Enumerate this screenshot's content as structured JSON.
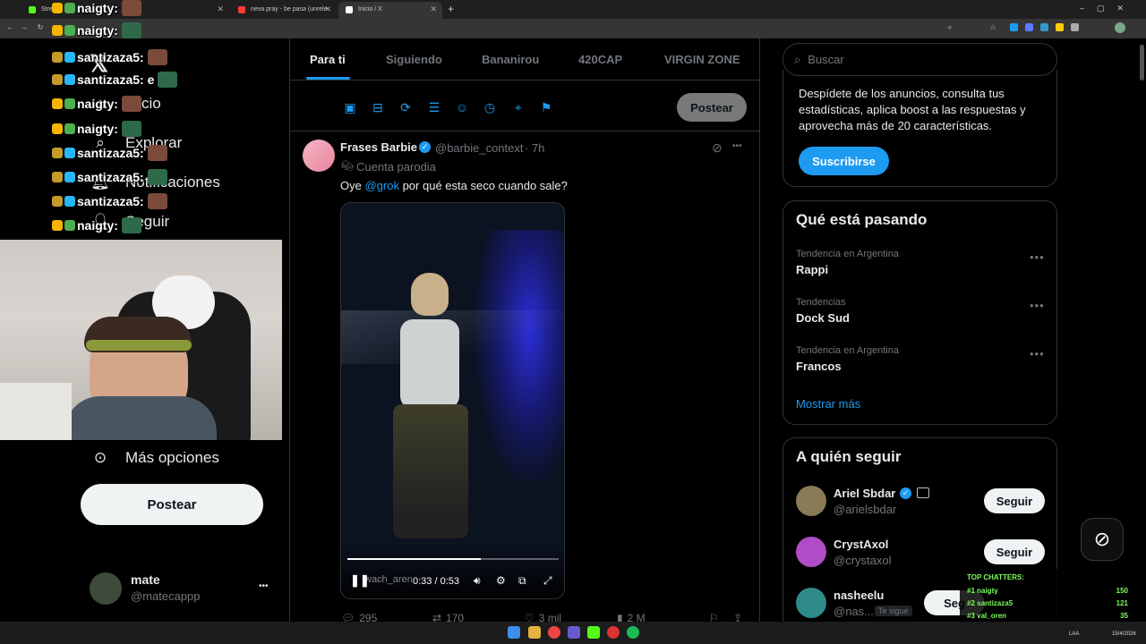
{
  "browser": {
    "tabs": [
      {
        "title": "Stream",
        "fav": "#53fc18"
      },
      {
        "title": "neva pray - be pasa (unrele",
        "fav": "#ff3b30"
      },
      {
        "title": "Inicio / X",
        "fav": "#ffffff"
      }
    ],
    "new_tab": "+",
    "url": "x.com/home"
  },
  "chat_overlay": [
    {
      "user": "naigty:",
      "badges": [
        "#f5b400",
        "#4caf50"
      ]
    },
    {
      "user": "naigty:",
      "badges": [
        "#f5b400",
        "#4caf50"
      ]
    },
    {
      "user": "santizaza5:",
      "badges": [
        "#c49a28",
        "#29b6f6"
      ]
    },
    {
      "user": "santizaza5: e",
      "badges": [
        "#c49a28",
        "#29b6f6"
      ]
    },
    {
      "user": "naigty:",
      "badges": [
        "#f5b400",
        "#4caf50"
      ]
    },
    {
      "user": "naigty:",
      "badges": [
        "#f5b400",
        "#4caf50"
      ]
    },
    {
      "user": "santizaza5:",
      "badges": [
        "#c49a28",
        "#29b6f6"
      ]
    },
    {
      "user": "santizaza5:",
      "badges": [
        "#c49a28",
        "#29b6f6"
      ]
    },
    {
      "user": "santizaza5:",
      "badges": [
        "#c49a28",
        "#29b6f6"
      ]
    },
    {
      "user": "naigty:",
      "badges": [
        "#f5b400",
        "#4caf50"
      ]
    }
  ],
  "left_nav": {
    "items": [
      {
        "label": "Inicio",
        "icon": "home-icon"
      },
      {
        "label": "Explorar",
        "icon": "search-icon"
      },
      {
        "label": "Notificaciones",
        "icon": "bell-icon"
      },
      {
        "label": "Seguir",
        "icon": "add-user-icon"
      }
    ],
    "more": "Más opciones",
    "post_button": "Postear",
    "account": {
      "name": "mate",
      "handle": "@matecappp",
      "menu": "•••"
    }
  },
  "feed": {
    "tabs": [
      "Para ti",
      "Siguiendo",
      "Bananirou",
      "420CAP",
      "VIRGIN ZONE"
    ],
    "active_tab": 0,
    "post_button": "Postear",
    "tweet": {
      "author": "Frases Barbie",
      "handle": "@barbie_context",
      "time": "· 7h",
      "label": "Cuenta parodia",
      "text_pre": "Oye ",
      "mention": "@grok",
      "text_post": " por qué esta seco cuando sale?",
      "video": {
        "time": "0:33 / 0:53",
        "watermark": "wach_aren",
        "progress": 0.63
      },
      "stats": {
        "replies": "295",
        "reposts": "170",
        "likes": "3 mil",
        "views": "2 M"
      }
    }
  },
  "right": {
    "search_placeholder": "Buscar",
    "premium_text": "Despídete de los anuncios, consulta tus estadísticas, aplica boost a las respuestas y aprovecha más de 20 características.",
    "subscribe": "Suscribirse",
    "trending": {
      "title": "Qué está pasando",
      "items": [
        {
          "category": "Tendencia en Argentina",
          "name": "Rappi"
        },
        {
          "category": "Tendencias",
          "name": "Dock Sud"
        },
        {
          "category": "Tendencia en Argentina",
          "name": "Francos"
        }
      ],
      "more": "Mostrar más",
      "dots": "•••"
    },
    "who_to_follow": {
      "title": "A quién seguir",
      "users": [
        {
          "name": "Ariel Sbdar",
          "handle": "@arielsbdar",
          "button": "Seguir",
          "color": "#8a7a55"
        },
        {
          "name": "CrystAxol",
          "handle": "@crystaxol",
          "button": "Seguir",
          "color": "#b04cc8"
        },
        {
          "name": "nasheelu",
          "handle": "@nas...",
          "tag": "Te sigue",
          "button": "Seg",
          "color": "#2f8a8a"
        }
      ]
    }
  },
  "top_chatters": {
    "title": "TOP CHATTERS:",
    "rows": [
      {
        "rank": "#1 naigty",
        "count": "150"
      },
      {
        "rank": "#2 santizaza5",
        "count": "121"
      },
      {
        "rank": "#3 val_oren",
        "count": "35"
      }
    ]
  },
  "taskbar": {
    "lang": "LAA",
    "date": "15/4/2026"
  }
}
